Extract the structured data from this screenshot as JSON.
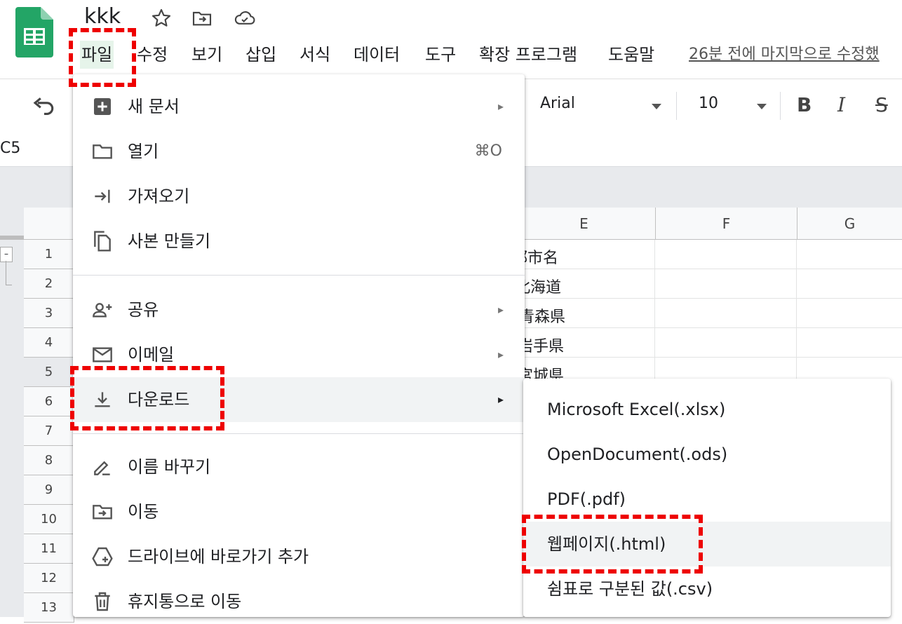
{
  "doc": {
    "title": "kkk"
  },
  "menubar": {
    "items": [
      {
        "id": "file",
        "label": "파일"
      },
      {
        "id": "edit",
        "label": "수정"
      },
      {
        "id": "view",
        "label": "보기"
      },
      {
        "id": "insert",
        "label": "삽입"
      },
      {
        "id": "format",
        "label": "서식"
      },
      {
        "id": "data",
        "label": "데이터"
      },
      {
        "id": "tools",
        "label": "도구"
      },
      {
        "id": "extensions",
        "label": "확장 프로그램"
      },
      {
        "id": "help",
        "label": "도움말"
      }
    ],
    "last_edit": "26분 전에 마지막으로 수정했"
  },
  "toolbar": {
    "font": "Arial",
    "font_size": "10",
    "bold_label": "B",
    "italic_label": "I",
    "strike_label": "S"
  },
  "formula_bar": {
    "cell_ref": "C5"
  },
  "grid": {
    "columns": [
      "E",
      "F",
      "G"
    ],
    "rows": [
      "1",
      "2",
      "3",
      "4",
      "5",
      "6",
      "7",
      "8",
      "9",
      "10",
      "11",
      "12",
      "13"
    ],
    "column_e_values": [
      "都市名",
      "北海道",
      "青森県",
      "岩手県",
      "宮城県"
    ]
  },
  "file_menu": {
    "items": [
      {
        "label": "새 문서",
        "icon": "plus-square-icon",
        "arrow": "▸"
      },
      {
        "label": "열기",
        "icon": "folder-icon",
        "shortcut": "⌘O"
      },
      {
        "label": "가져오기",
        "icon": "import-icon"
      },
      {
        "label": "사본 만들기",
        "icon": "copy-icon"
      },
      {
        "label": "공유",
        "icon": "person-add-icon",
        "arrow": "▸"
      },
      {
        "label": "이메일",
        "icon": "mail-icon",
        "arrow": "▸"
      },
      {
        "label": "다운로드",
        "icon": "download-icon",
        "arrow": "▸"
      },
      {
        "label": "이름 바꾸기",
        "icon": "pencil-icon"
      },
      {
        "label": "이동",
        "icon": "move-folder-icon"
      },
      {
        "label": "드라이브에 바로가기 추가",
        "icon": "drive-shortcut-icon"
      },
      {
        "label": "휴지통으로 이동",
        "icon": "trash-icon"
      }
    ]
  },
  "download_submenu": {
    "items": [
      {
        "label": "Microsoft Excel(.xlsx)"
      },
      {
        "label": "OpenDocument(.ods)"
      },
      {
        "label": "PDF(.pdf)"
      },
      {
        "label": "웹페이지(.html)"
      },
      {
        "label": "쉼표로 구분된 값(.csv)"
      }
    ]
  },
  "colors": {
    "sheets_green": "#23a566",
    "annotation_red": "#e00000",
    "hover_gray": "#f1f3f4",
    "menu_file_bg": "#e6f4ea"
  }
}
